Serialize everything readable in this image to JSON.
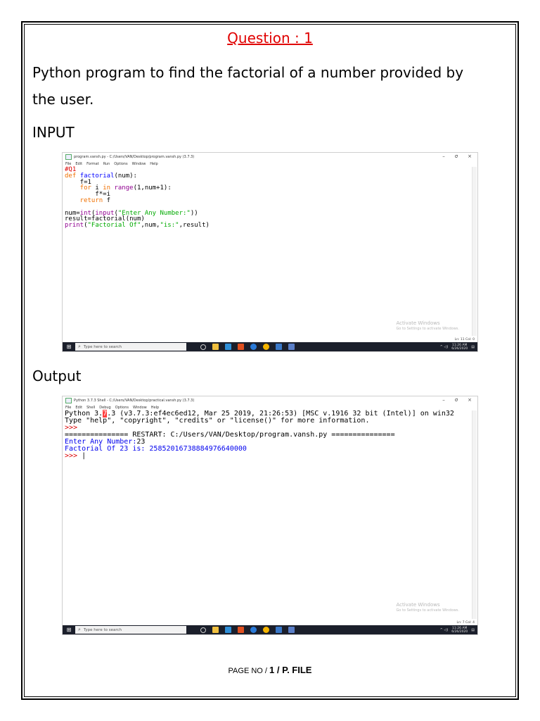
{
  "document": {
    "heading": "Question : 1",
    "question_line1": "Python program to find the factorial of a number provided by",
    "question_line2": "the user.",
    "input_label": "INPUT",
    "output_label": "Output",
    "page_no_prefix": "PAGE NO  / ",
    "page_no_value": "1 / P. FILE",
    "colors": {
      "heading": "#e00000",
      "text": "#000000",
      "border": "#000000"
    }
  },
  "editor_window": {
    "title": "program.vansh.py - C:/Users/VAN/Desktop/program.vansh.py (3.7.3)",
    "menu": [
      "File",
      "Edit",
      "Format",
      "Run",
      "Options",
      "Window",
      "Help"
    ],
    "code": {
      "comment": "#Q1",
      "def_kw": "def",
      "fn_name": "factorial",
      "fn_sig": "(num):",
      "l_f1": "    f=1",
      "l_for_kw": "    for",
      "l_for_i": " i ",
      "l_in_kw": "in",
      "l_range": "range",
      "l_for_tail": "(1,num+1):",
      "l_fmul": "        f*=i",
      "l_return_kw": "    return",
      "l_return_tail": " f",
      "l_num_pre": "num=",
      "l_int": "int",
      "l_paren1": "(",
      "l_input": "input",
      "l_paren2": "(",
      "l_prompt": "\"Enter Any Number:\"",
      "l_close": "))",
      "l_result": "result=factorial(num)",
      "l_print": "print",
      "l_print_open": "(",
      "l_print_s1": "\"Factorial Of\"",
      "l_print_mid": ",num,",
      "l_print_s2": "\"is:\"",
      "l_print_tail": ",result)"
    },
    "activate_title": "Activate Windows",
    "activate_sub": "Go to Settings to activate Windows.",
    "status": "Ln: 11  Col: 0"
  },
  "shell_window": {
    "title": "Python 3.7.3 Shell - C:/Users/VAN/Desktop/practical.vansh.py (3.7.3)",
    "menu": [
      "File",
      "Edit",
      "Shell",
      "Debug",
      "Options",
      "Window",
      "Help"
    ],
    "line1_a": "Python 3.",
    "line1_hl": "7",
    "line1_b": ".3 (v3.7.3:ef4ec6ed12, Mar 25 2019, 21:26:53) [MSC v.1916 32 bit (Intel)] on win32",
    "line2": "Type \"help\", \"copyright\", \"credits\" or \"license()\" for more information.",
    "prompt1": ">>> ",
    "restart": "=============== RESTART: C:/Users/VAN/Desktop/program.vansh.py ===============",
    "enter_prompt": "Enter Any Number:",
    "entered": "23",
    "result_line": "Factorial Of 23 is: 25852016738884976640000",
    "prompt2": ">>> ",
    "activate_title": "Activate Windows",
    "activate_sub": "Go to Settings to activate Windows.",
    "status": "Ln: 7  Col: 4"
  },
  "taskbar": {
    "search_placeholder": "Type here to search",
    "time_1": "11:26 AM",
    "date_1": "6/26/2020",
    "time_2": "11:26 AM",
    "date_2": "6/26/2020"
  }
}
